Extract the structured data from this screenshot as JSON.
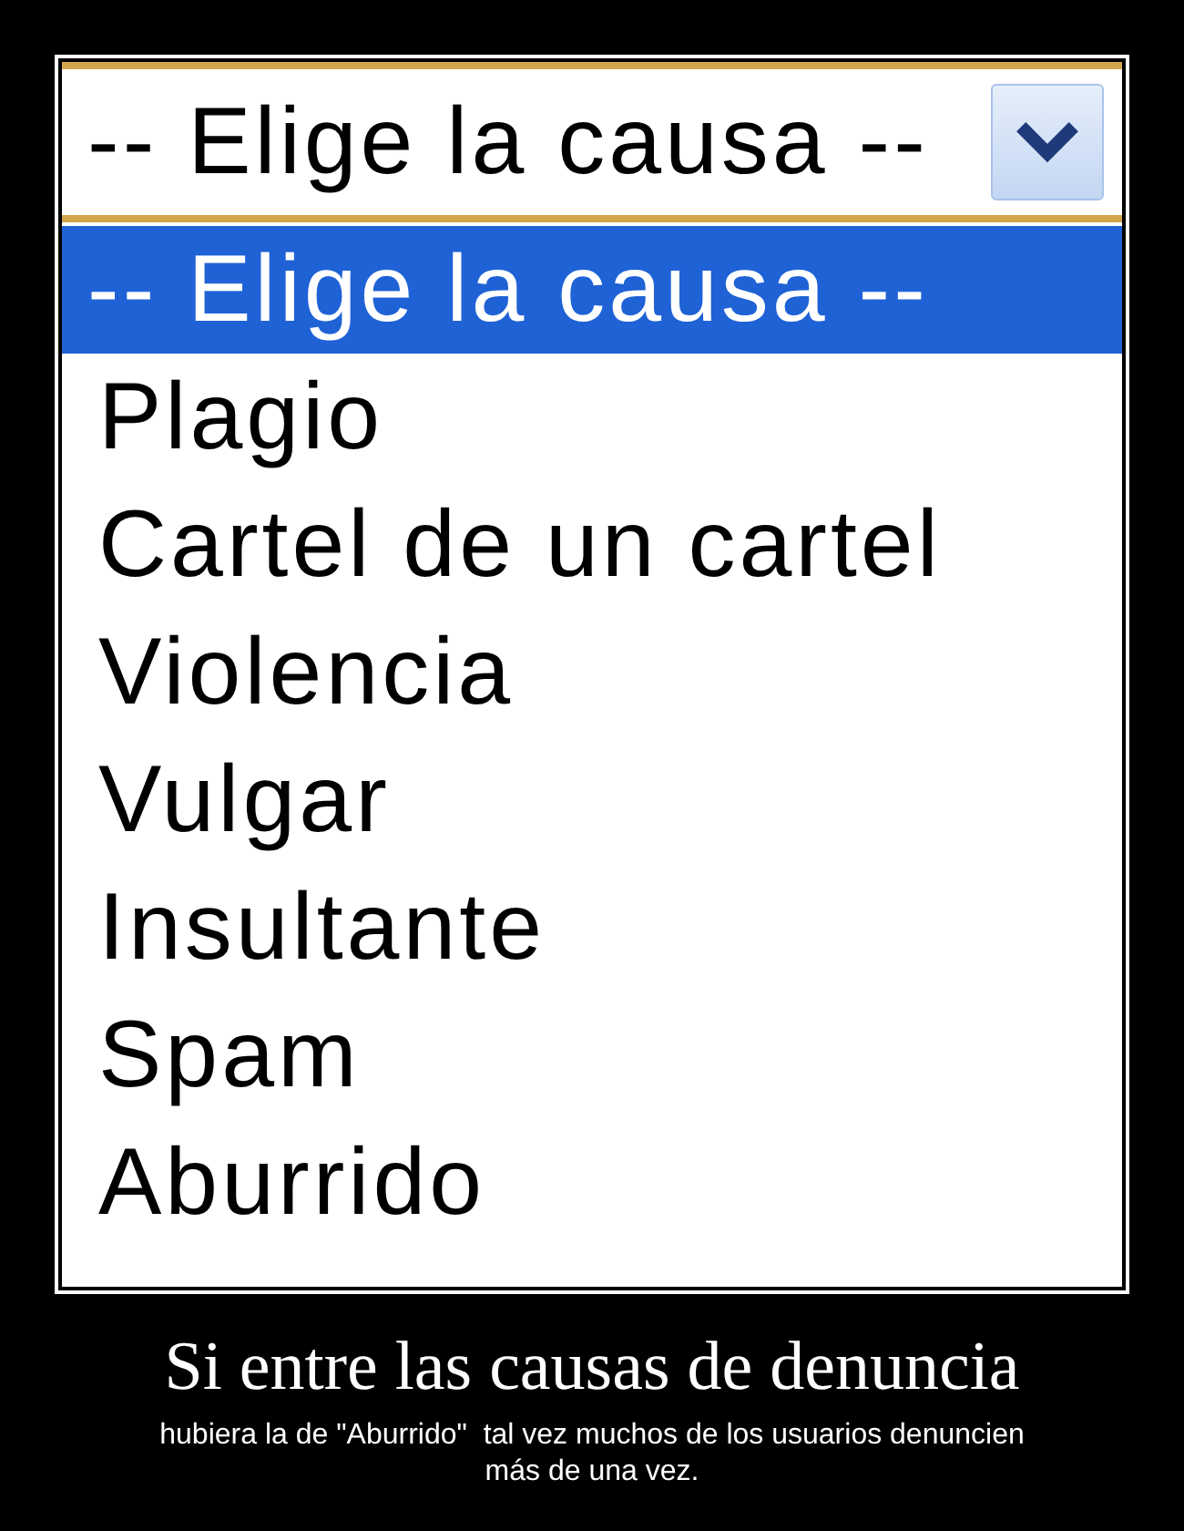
{
  "select": {
    "value": "-- Elige la causa --",
    "expanded": true
  },
  "options": [
    {
      "label": "-- Elige la causa --",
      "selected": true
    },
    {
      "label": "Plagio",
      "selected": false
    },
    {
      "label": "Cartel de un cartel",
      "selected": false
    },
    {
      "label": "Violencia",
      "selected": false
    },
    {
      "label": "Vulgar",
      "selected": false
    },
    {
      "label": "Insultante",
      "selected": false
    },
    {
      "label": "Spam",
      "selected": false
    },
    {
      "label": "Aburrido",
      "selected": false
    }
  ],
  "caption": {
    "title": "Si entre las causas de denuncia",
    "text": "hubiera la de \"Aburrido\"  tal vez muchos de los usuarios denuncien más de una vez."
  }
}
